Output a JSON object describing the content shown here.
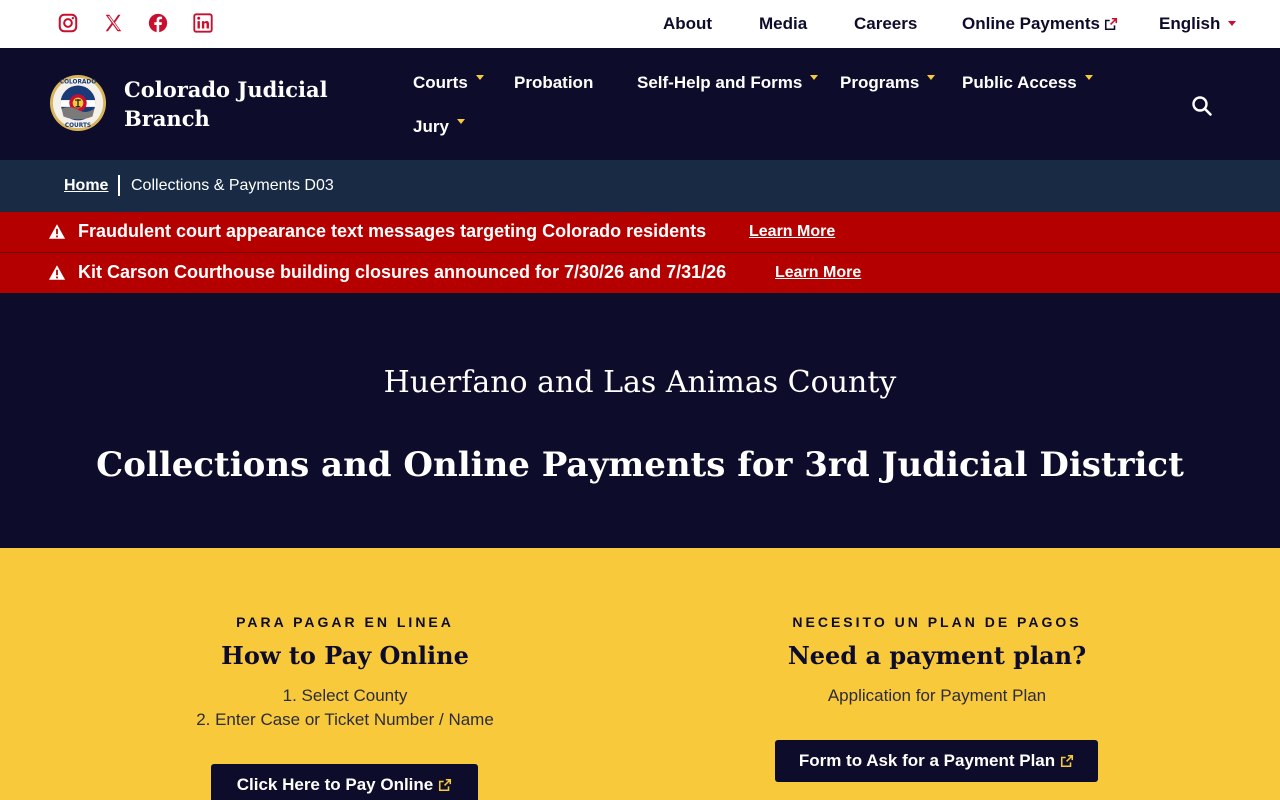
{
  "social": [
    {
      "name": "instagram-icon",
      "label": "Instagram"
    },
    {
      "name": "x-twitter-icon",
      "label": "X"
    },
    {
      "name": "facebook-icon",
      "label": "Facebook"
    },
    {
      "name": "linkedin-icon",
      "label": "LinkedIn"
    }
  ],
  "utility_nav": {
    "about": "About",
    "media": "Media",
    "careers": "Careers",
    "online_payments": "Online Payments",
    "language": "English"
  },
  "brand": {
    "line1": "Colorado Judicial",
    "line2": "Branch"
  },
  "main_nav": {
    "courts": "Courts",
    "probation": "Probation",
    "self_help": "Self-Help and Forms",
    "programs": "Programs",
    "public_access": "Public Access",
    "jury": "Jury"
  },
  "breadcrumb": {
    "home": "Home",
    "current": "Collections & Payments D03"
  },
  "alerts": [
    {
      "message": "Fraudulent court appearance text messages targeting Colorado residents",
      "link": "Learn More"
    },
    {
      "message": "Kit Carson Courthouse building closures announced for 7/30/26 and 7/31/26",
      "link": "Learn More"
    }
  ],
  "hero": {
    "subtitle": "Huerfano and Las Animas County",
    "title": "Collections and Online Payments for 3rd Judicial District"
  },
  "pay_online": {
    "eyebrow": "PARA PAGAR EN LINEA",
    "heading": "How to Pay Online",
    "step1": "1. Select County",
    "step2": "2. Enter Case or Ticket Number / Name",
    "button": "Click Here to Pay Online"
  },
  "payment_plan": {
    "eyebrow": "NECESITO UN PLAN DE PAGOS",
    "heading": "Need a payment plan?",
    "description": "Application for Payment Plan",
    "button": "Form to Ask for a Payment Plan"
  },
  "colors": {
    "navy": "#0d0c2b",
    "breadcrumb_bg": "#182a44",
    "alert_red": "#b50000",
    "gold": "#f8c93b",
    "social_red": "#c8102e"
  }
}
